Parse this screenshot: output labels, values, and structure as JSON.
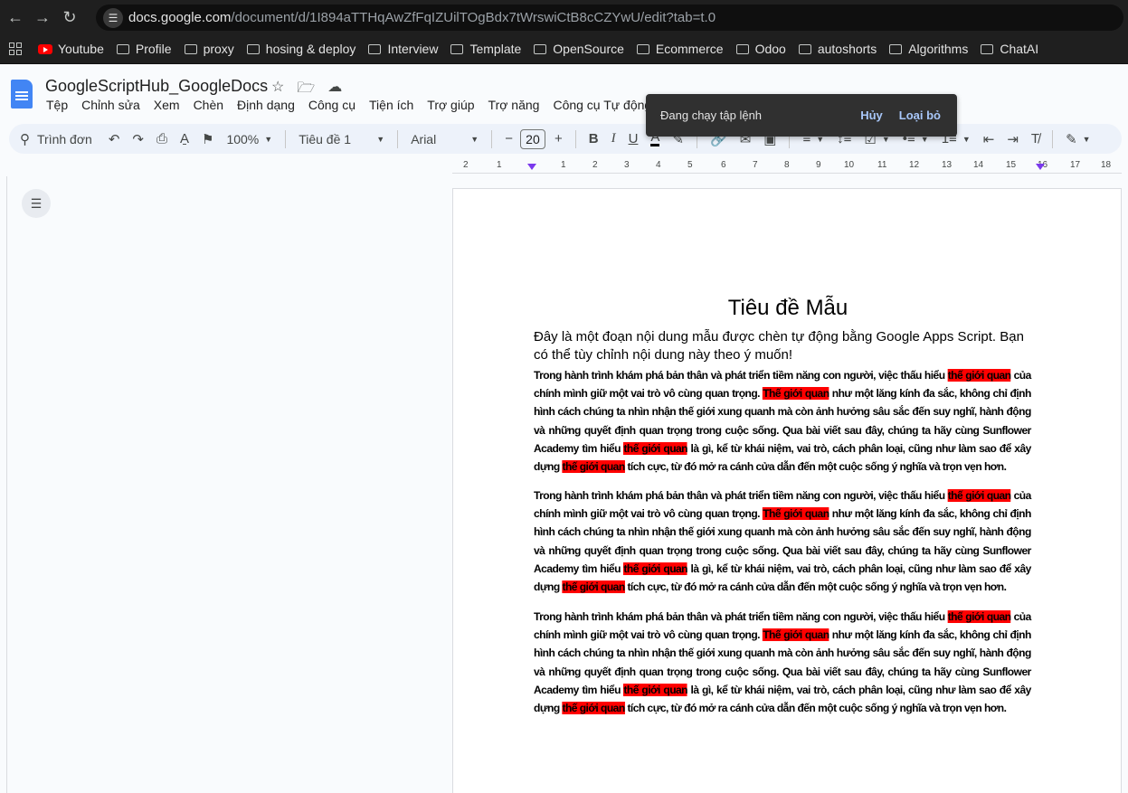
{
  "browser": {
    "url_host": "docs.google.com",
    "url_path": "/document/d/1I894aTTHqAwZfFqIZUilTOgBdx7tWrswiCtB8cCZYwU/edit?tab=t.0",
    "bookmarks": [
      "Youtube",
      "Profile",
      "proxy",
      "hosing & deploy",
      "Interview",
      "Template",
      "OpenSource",
      "Ecommerce",
      "Odoo",
      "autoshorts",
      "Algorithms",
      "ChatAI"
    ]
  },
  "doc": {
    "title": "GoogleScriptHub_GoogleDocs",
    "menus": [
      "Tệp",
      "Chỉnh sửa",
      "Xem",
      "Chèn",
      "Định dạng",
      "Công cụ",
      "Tiện ích",
      "Trợ giúp",
      "Trợ năng",
      "Công cụ Tự động"
    ]
  },
  "toast": {
    "message": "Đang chạy tập lệnh",
    "cancel": "Hủy",
    "dismiss": "Loại bỏ"
  },
  "toolbar": {
    "search": "Trình đơn",
    "zoom": "100%",
    "style": "Tiêu đề 1",
    "font": "Arial",
    "font_size": "20"
  },
  "ruler": [
    "2",
    "1",
    "1",
    "2",
    "3",
    "4",
    "5",
    "6",
    "7",
    "8",
    "9",
    "10",
    "11",
    "12",
    "13",
    "14",
    "15",
    "16",
    "17",
    "18"
  ],
  "content": {
    "heading": "Tiêu đề Mẫu",
    "intro": "Đây là một đoạn nội dung mẫu được chèn tự động bằng Google Apps Script. Bạn có thể tùy chỉnh nội dung này theo ý muốn!",
    "paragraph": {
      "s1": "Trong hành trình khám phá bản thân và phát triển tiềm năng con người, việc thấu hiểu ",
      "h1": "thế giới quan",
      "s2": " của chính mình giữ một vai trò vô cùng quan trọng. ",
      "h2": "Thế giới quan",
      "s3": " như một lăng kính đa sắc, không chỉ định hình cách chúng ta nhìn nhận thế giới xung quanh mà còn ảnh hưởng sâu sắc đến suy nghĩ, hành động và những quyết định quan trọng trong cuộc sống. Qua bài viết sau đây, chúng ta hãy cùng Sunflower Academy tìm hiểu ",
      "h3": "thế giới quan",
      "s4": " là gì, kể từ khái niệm, vai trò, cách phân loại, cũng như làm sao để xây dựng ",
      "h4": "thế giới quan",
      "s5": " tích cực, từ đó mở ra cánh cửa dẫn đến một cuộc sống ý nghĩa và trọn vẹn hơn."
    }
  }
}
